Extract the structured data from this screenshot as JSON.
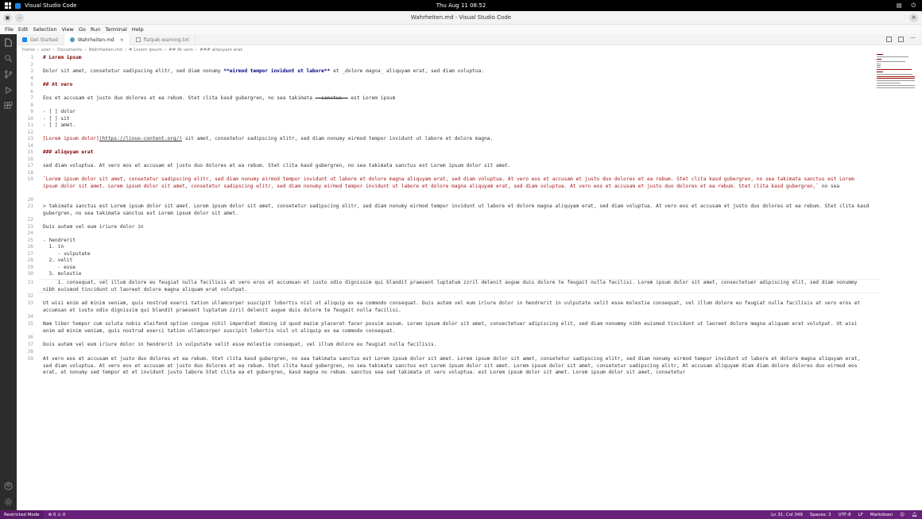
{
  "topbar": {
    "app_name": "Visual Studio Code",
    "clock": "Thu Aug 11  08:52"
  },
  "window": {
    "title": "Wahrheiten.md - Visual Studio Code"
  },
  "menu": [
    "File",
    "Edit",
    "Selection",
    "View",
    "Go",
    "Run",
    "Terminal",
    "Help"
  ],
  "tabs": [
    {
      "label": "Get Started",
      "active": false
    },
    {
      "label": "Wahrheiten.md",
      "active": true
    },
    {
      "label": "flatpak-warning.txt",
      "active": false
    }
  ],
  "breadcrumb": [
    "home",
    "user",
    "Documents",
    "Wahrheiten.md",
    "# Lorem ipsum",
    "## At vero",
    "### aliquyam erat"
  ],
  "editor_lines": {
    "l1": "# Lorem ipsum",
    "l3a": "Dolor sit amet, consetetur sadipscing elitr, sed diam nonumy ",
    "l3b": "**eirmod tempor invidunt ut labore**",
    "l3c": " et ",
    "l3d": "_dolore magna_",
    "l3e": " aliquyam erat, sed diam voluptua.",
    "l5": "## At vero",
    "l7a": "Eos et accusam et justo duo dolores et ea rebum. Stet clita kasd gubergren, no sea takimata ",
    "l7b": "~~sanctus~~",
    "l7c": " est Lorem ipsum",
    "l9": "- [ ] dolor",
    "l10": "- [ ] sit",
    "l11": "- [ ] amet.",
    "l13a": "[Lorem ipsum dolor]",
    "l13b": "(https://linux-content.org/)",
    "l13c": " sit amet, consetetur sadipscing elitr, sed diam nonumy eirmod tempor invidunt ut labore et dolore magna.",
    "l15": "### aliquyam erat",
    "l17": "sed diam voluptua. At vero eos et accusam et justo duo dolores et ea rebum. Stet clita kasd gubergren, no sea takimata sanctus est Lorem ipsum dolor sit amet.",
    "l19a": "`Lorem ipsum dolor sit amet, consetetur sadipscing elitr, sed diam nonumy eirmod tempor invidunt ut labore et dolore magna aliquyam erat, sed diam voluptua. At vero eos et accusam et justo duo dolores et ea rebum. Stet clita kasd gubergren, no sea takimata sanctus est Lorem ipsum dolor sit amet. Lorem ipsum dolor sit amet, consetetur sadipscing elitr, sed diam nonumy eirmod tempor invidunt ut labore et dolore magna aliquyam erat, sed diam voluptua. At vero eos et accusam et justo duo dolores et ea rebum. Stet clita kasd gubergren,`",
    "l19b": " no sea",
    "l21": "> takimata sanctus est Lorem ipsum dolor sit amet. Lorem ipsum dolor sit amet, consetetur sadipscing elitr, sed diam nonumy eirmod tempor invidunt ut labore et dolore magna aliquyam erat, sed diam voluptua. At vero eos et accusam et justo duo dolores et ea rebum. Stet clita kasd gubergren, no sea takimata sanctus est Lorem ipsum dolor sit amet.",
    "l23": "Duis autem vel eum iriure dolor in",
    "l25": "- hendrerit",
    "l26": "  1. in",
    "l27": "     - vulputate",
    "l28": "  2. velit",
    "l29": "     - esse",
    "l30": "  3. molestie",
    "l31": "     1. consequat, vel illum dolore eu feugiat nulla facilisis at vero eros et accumsan et iusto odio dignissim qui blandit praesent luptatum zzril delenit augue duis dolore te feugait nulla facilisi. Lorem ipsum dolor sit amet, consectetuer adipiscing elit, sed diam nonummy nibh euismod tincidunt ut laoreet dolore magna aliquam erat volutpat.",
    "l33": "Ut wisi enim ad minim veniam, quis nostrud exerci tation ullamcorper suscipit lobortis nisl ut aliquip ex ea commodo consequat. Duis autem vel eum iriure dolor in hendrerit in vulputate velit esse molestie consequat, vel illum dolore eu feugiat nulla facilisis at vero eros et accumsan et iusto odio dignissim qui blandit praesent luptatum zzril delenit augue duis dolore te feugait nulla facilisi.",
    "l35": "Nam liber tempor cum soluta nobis eleifend option congue nihil imperdiet doming id quod mazim placerat facer possim assum. Lorem ipsum dolor sit amet, consectetuer adipiscing elit, sed diam nonummy nibh euismod tincidunt ut laoreet dolore magna aliquam erat volutpat. Ut wisi enim ad minim veniam, quis nostrud exerci tation ullamcorper suscipit lobortis nisl ut aliquip ex ea commodo consequat.",
    "l37": "Duis autem vel eum iriure dolor in hendrerit in vulputate velit esse molestie consequat, vel illum dolore eu feugiat nulla facilisis.",
    "l39": "At vero eos et accusam et justo duo dolores et ea rebum. Stet clita kasd gubergren, no sea takimata sanctus est Lorem ipsum dolor sit amet. Lorem ipsum dolor sit amet, consetetur sadipscing elitr, sed diam nonumy eirmod tempor invidunt ut labore et dolore magna aliquyam erat, sed diam voluptua. At vero eos et accusam et justo duo dolores et ea rebum. Stet clita kasd gubergren, no sea takimata sanctus est Lorem ipsum dolor sit amet. Lorem ipsum dolor sit amet, consetetur sadipscing elitr, At accusam aliquyam diam diam dolore dolores duo eirmod eos erat, et nonumy sed tempor et et invidunt justo labore Stet clita ea et gubergren, kasd magna no rebum. sanctus sea sed takimata ut vero voluptua. est Lorem ipsum dolor sit amet. Lorem ipsum dolor sit amet, consetetur"
  },
  "status": {
    "restricted": "Restricted Mode",
    "problems": "⊗ 0  ⚠ 0",
    "cursor": "Ln 31, Col 349",
    "spaces": "Spaces: 3",
    "encoding": "UTF-8",
    "eol": "LF",
    "language": "Markdown"
  },
  "colors": {
    "statusbar": "#68217a",
    "activitybar": "#2c2c2c",
    "heading": "#800000",
    "bold": "#000080",
    "link": "#a31515"
  }
}
